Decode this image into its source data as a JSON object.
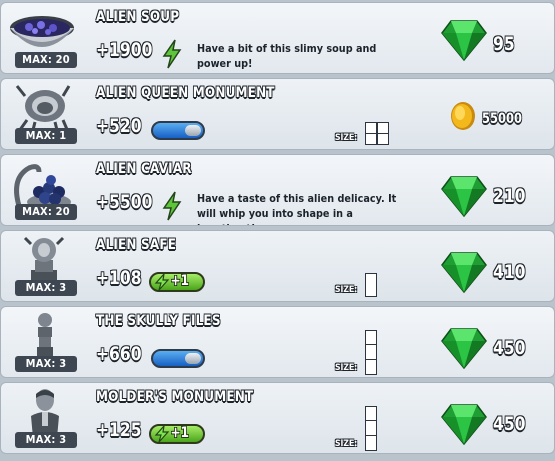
{
  "shop": {
    "items": [
      {
        "title": "ALIEN SOUP",
        "max": "MAX: 20",
        "stat": "+1900",
        "bonus": "energy",
        "description": "Have a bit of this slimy soup and power up!",
        "currency": "gem",
        "price": "95",
        "icon": "soup-bowl-icon"
      },
      {
        "title": "ALIEN QUEEN MONUMENT",
        "max": "MAX: 1",
        "stat": "+520",
        "bonus": "blue-pill",
        "size_label": "SIZE:",
        "size": "2x2",
        "currency": "coin",
        "price": "55000",
        "icon": "alien-queen-statue-icon"
      },
      {
        "title": "ALIEN CAVIAR",
        "max": "MAX: 20",
        "stat": "+5500",
        "bonus": "energy",
        "description": "Have a taste of this alien delicacy. It will whip you into shape in a heartbeat!",
        "currency": "gem",
        "price": "210",
        "icon": "alien-caviar-icon"
      },
      {
        "title": "ALIEN SAFE",
        "max": "MAX: 3",
        "stat": "+108",
        "bonus": "green-pill",
        "bonus_text": "+1",
        "size_label": "SIZE:",
        "size": "1x1",
        "currency": "gem",
        "price": "410",
        "icon": "alien-safe-icon"
      },
      {
        "title": "THE SKULLY FILES",
        "max": "MAX: 3",
        "stat": "+660",
        "bonus": "blue-pill",
        "size_label": "SIZE:",
        "size": "1x3",
        "currency": "gem",
        "price": "450",
        "icon": "skully-files-statue-icon"
      },
      {
        "title": "MOLDER'S MONUMENT",
        "max": "MAX: 3",
        "stat": "+125",
        "bonus": "green-pill",
        "bonus_text": "+1",
        "size_label": "SIZE:",
        "size": "1x3",
        "currency": "gem",
        "price": "450",
        "icon": "molder-statue-icon"
      }
    ]
  },
  "colors": {
    "gem_green": "#22b43a",
    "coin_gold": "#f2b81c",
    "pill_blue": "#1f6fd6",
    "pill_green": "#6fd234",
    "energy_green": "#5ec43a"
  }
}
